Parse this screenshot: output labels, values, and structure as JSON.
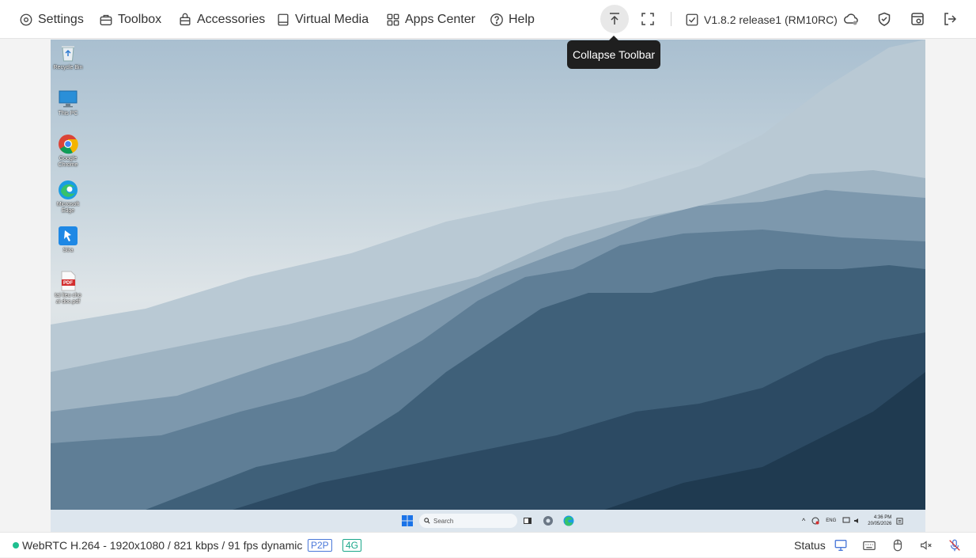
{
  "toolbar": {
    "settings_label": "Settings",
    "toolbox_label": "Toolbox",
    "accessories_label": "Accessories",
    "virtual_media_label": "Virtual Media",
    "apps_center_label": "Apps Center",
    "help_label": "Help",
    "version_label": "V1.8.2 release1 (RM10RC)",
    "tooltip": "Collapse Toolbar"
  },
  "desktop": {
    "icons": [
      {
        "label": "Recycle Bin"
      },
      {
        "label": "This PC"
      },
      {
        "label": "Google Chrome"
      },
      {
        "label": "Microsoft Edge"
      },
      {
        "label": "Sửa"
      },
      {
        "label": "tai lieu cho ai doc.pdf"
      }
    ],
    "pdf_badge": "PDF"
  },
  "taskbar": {
    "search_placeholder": "Search",
    "lang": "ENG",
    "time": "4:36 PM",
    "date": "20/05/2026"
  },
  "statusbar": {
    "stream_info": "WebRTC H.264 - 1920x1080 / 821 kbps / 91 fps dynamic",
    "p2p_badge": "P2P",
    "network_badge": "4G",
    "status_label": "Status"
  },
  "colors": {
    "accent_green": "#1fbf8f",
    "p2p_blue": "#4a78d9",
    "net_green": "#1aa78a"
  }
}
